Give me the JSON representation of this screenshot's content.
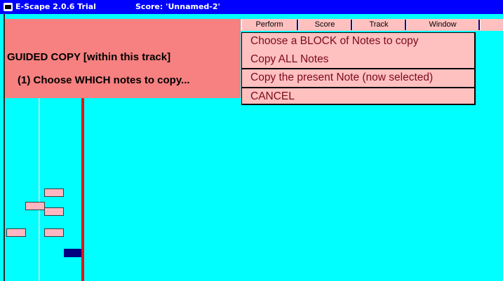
{
  "titlebar": {
    "app_title": "E-Scape 2.0.6 Trial",
    "score_title": "Score: 'Unnamed-2'"
  },
  "menubar": {
    "items": [
      "Perform",
      "Score",
      "Track",
      "Window",
      ""
    ]
  },
  "guide_panel": {
    "title": "GUIDED COPY   [within this track]",
    "step": "(1) Choose WHICH notes to copy..."
  },
  "popup_menu": {
    "items": [
      "Choose a BLOCK of Notes to copy",
      "Copy ALL Notes",
      "Copy the present Note (now selected)",
      "CANCEL"
    ]
  },
  "colors": {
    "titlebar": "#0000ff",
    "canvas": "#00ffff",
    "guide_panel": "#f78080",
    "menu": "#ffc0c0",
    "popup_text": "#7a0a1a",
    "playhead": "#e81212",
    "note": "#ffb6c1",
    "selected_note": "#000080"
  },
  "icons": {
    "app_icon": "app-icon"
  }
}
